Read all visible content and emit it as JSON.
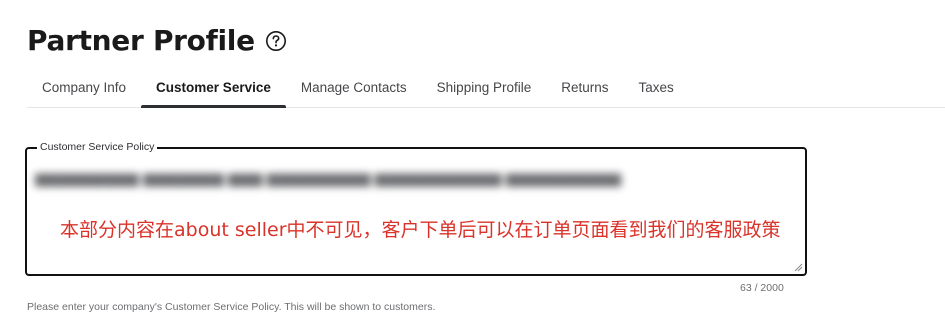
{
  "header": {
    "title": "Partner Profile",
    "help_icon": "question-circle-icon"
  },
  "tabs": [
    {
      "label": "Company Info",
      "active": false
    },
    {
      "label": "Customer Service",
      "active": true
    },
    {
      "label": "Manage Contacts",
      "active": false
    },
    {
      "label": "Shipping Profile",
      "active": false
    },
    {
      "label": "Returns",
      "active": false
    },
    {
      "label": "Taxes",
      "active": false
    }
  ],
  "policy_field": {
    "label": "Customer Service Policy",
    "annotation": "本部分内容在about seller中不可见，客户下单后可以在订单页面看到我们的客服政策",
    "counter": "63 / 2000",
    "helper_text": "Please enter your company's Customer Service Policy. This will be shown to customers."
  },
  "colors": {
    "annotation": "#d9332a",
    "active_tab_underline": "#2e2f32",
    "field_border": "#111111"
  }
}
